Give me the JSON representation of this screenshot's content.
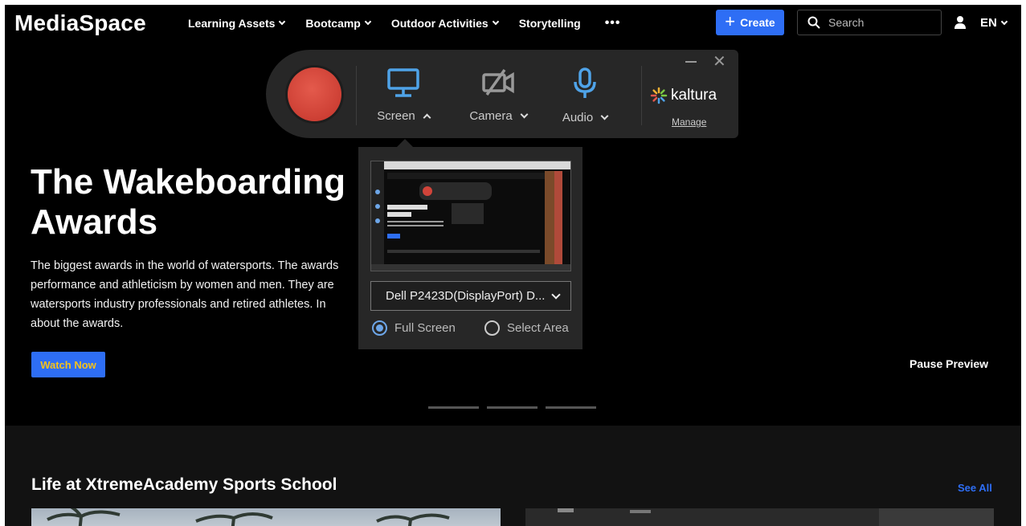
{
  "app": {
    "name": "MediaSpace"
  },
  "nav": {
    "items": [
      {
        "label": "Learning Assets",
        "has_dropdown": true
      },
      {
        "label": "Bootcamp",
        "has_dropdown": true
      },
      {
        "label": "Outdoor Activities",
        "has_dropdown": true
      },
      {
        "label": "Storytelling",
        "has_dropdown": false
      }
    ],
    "more": "•••",
    "create_label": "Create",
    "search_placeholder": "Search",
    "language": "EN"
  },
  "hero": {
    "title_line1": "The Wakeboarding",
    "title_line2": "Awards",
    "desc_line1": "The biggest awards in the world of watersports. The awards",
    "desc_line2": "performance and athleticism by women and men. They are",
    "desc_line3": "watersports industry professionals and retired athletes. In",
    "desc_line4": "about the awards.",
    "watch_label": "Watch Now",
    "pause_label": "Pause Preview"
  },
  "recorder": {
    "screen_label": "Screen",
    "camera_label": "Camera",
    "audio_label": "Audio",
    "brand": "kaltura",
    "manage_label": "Manage",
    "close_glyph": "✕",
    "display_selected": "Dell P2423D(DisplayPort) D...",
    "options": {
      "full_screen": "Full Screen",
      "select_area": "Select Area"
    },
    "selected_option": "full_screen"
  },
  "section": {
    "title": "Life at XtremeAcademy Sports School",
    "see_all": "See All"
  },
  "colors": {
    "accent": "#2e6ef5",
    "record": "#d1443a",
    "watch_text": "#f5c21b",
    "tool_icon": "#4fa3e8"
  }
}
